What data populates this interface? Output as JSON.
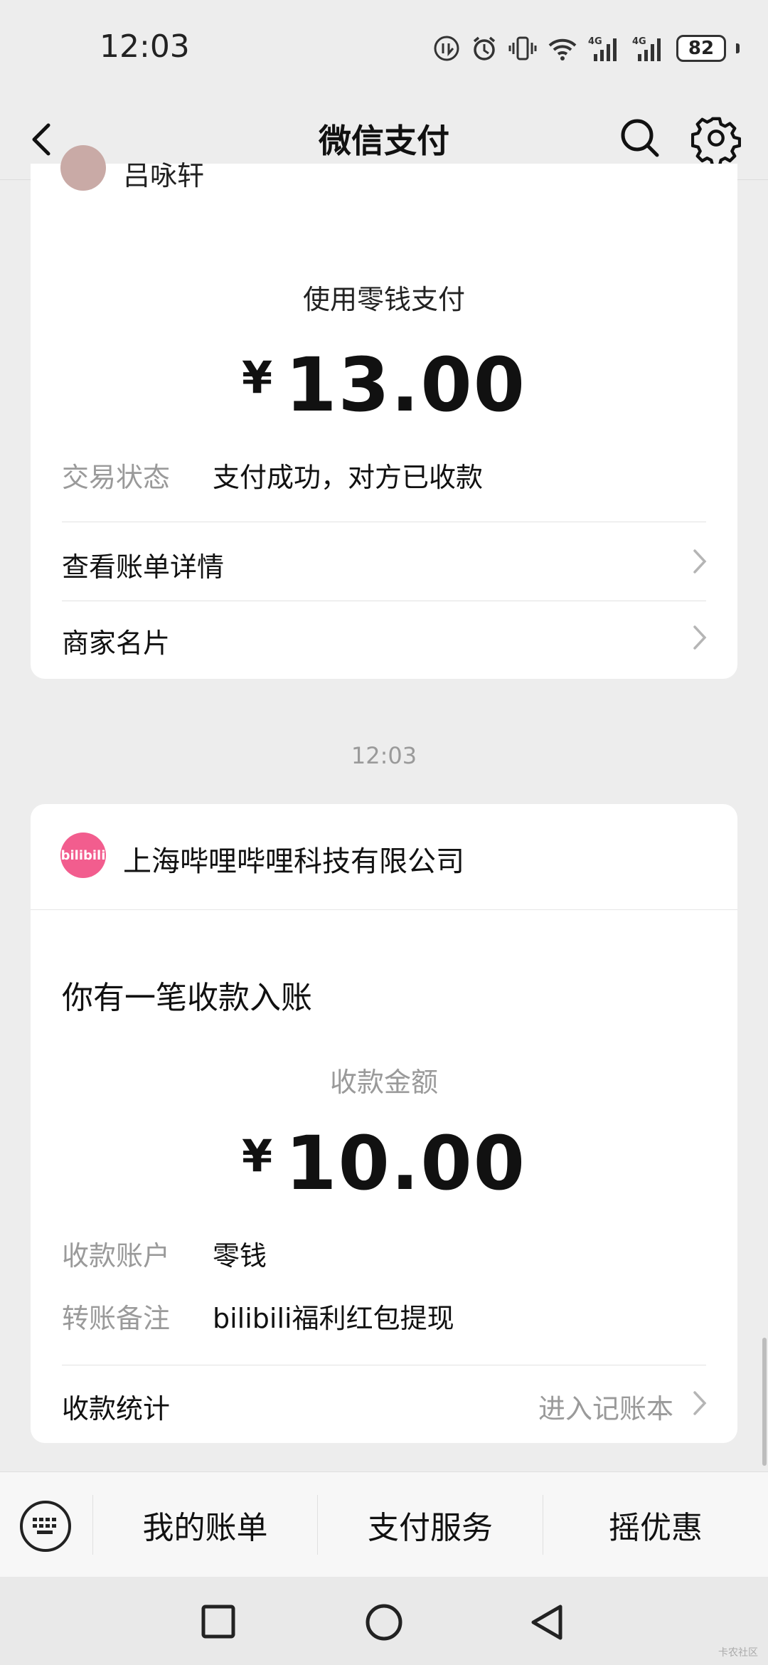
{
  "status_bar": {
    "time": "12:03",
    "battery": "82"
  },
  "nav": {
    "title": "微信支付"
  },
  "card1": {
    "merchant": "吕咏轩",
    "pay_method": "使用零钱支付",
    "currency": "¥",
    "amount": "13.00",
    "status_label": "交易状态",
    "status_value": "支付成功，对方已收款",
    "row_details": "查看账单详情",
    "row_merchant_card": "商家名片"
  },
  "time_separator": "12:03",
  "card2": {
    "logo_text": "bilibili",
    "merchant": "上海哔哩哔哩科技有限公司",
    "headline": "你有一笔收款入账",
    "amount_label": "收款金额",
    "currency": "¥",
    "amount": "10.00",
    "account_label": "收款账户",
    "account_value": "零钱",
    "note_label": "转账备注",
    "note_value": "bilibili福利红包提现",
    "stats_label": "收款统计",
    "stats_link": "进入记账本"
  },
  "bottom_menu": {
    "items": [
      "我的账单",
      "支付服务",
      "摇优惠"
    ]
  },
  "watermark": "卡农社区",
  "colors": {
    "bili_pink": "#f25d8e",
    "page_bg": "#ededed"
  }
}
